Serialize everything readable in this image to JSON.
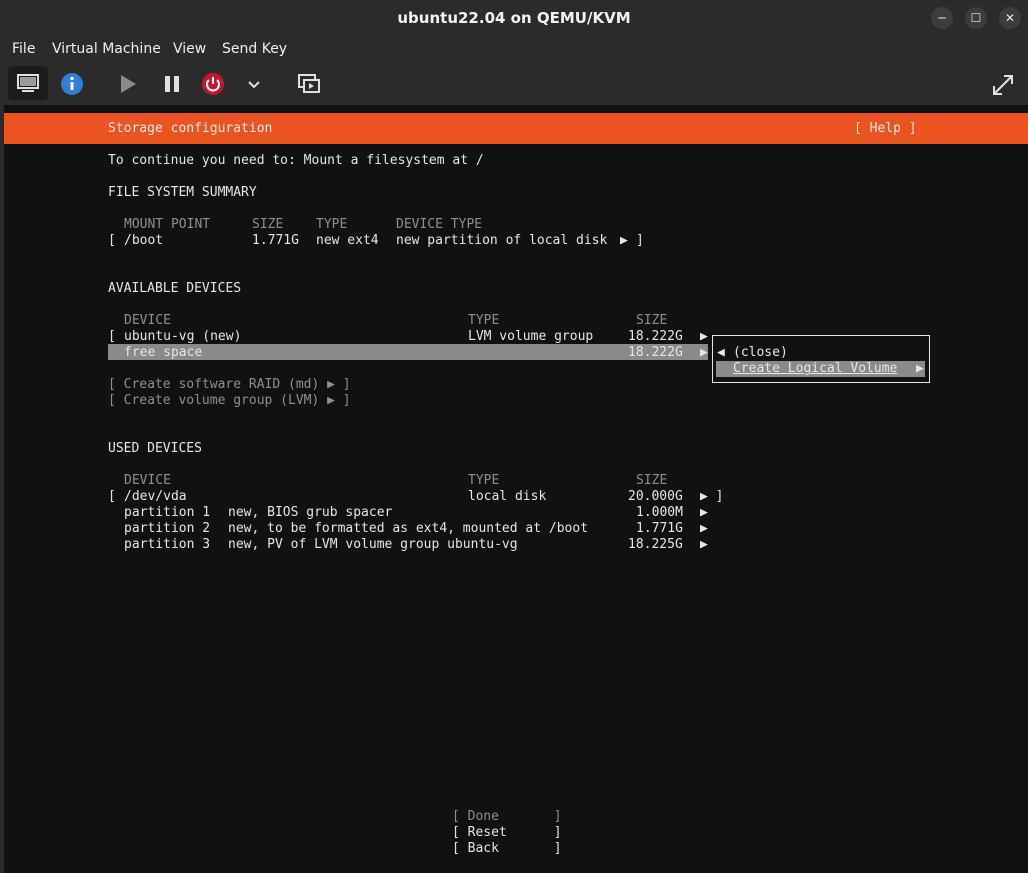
{
  "window": {
    "title": "ubuntu22.04 on QEMU/KVM",
    "controls": [
      "─",
      "☐",
      "✕"
    ]
  },
  "menubar": [
    "File",
    "Virtual Machine",
    "View",
    "Send Key"
  ],
  "installer": {
    "header_title": "Storage configuration",
    "help": "[ Help ]",
    "instruction": "To continue you need to: Mount a filesystem at /",
    "fs_summary": {
      "heading": "FILE SYSTEM SUMMARY",
      "columns": [
        "MOUNT POINT",
        "SIZE",
        "TYPE",
        "DEVICE TYPE"
      ],
      "row": {
        "bracket_open": "[",
        "mount": "/boot",
        "size": "1.771G",
        "type": "new ext4",
        "device_type": "new partition of local disk",
        "arrow": "▶",
        "bracket_close": "]"
      }
    },
    "available": {
      "heading": "AVAILABLE DEVICES",
      "columns": [
        "DEVICE",
        "TYPE",
        "SIZE"
      ],
      "vg_row": {
        "bracket": "[",
        "name": "ubuntu-vg (new)",
        "type": "LVM volume group",
        "size": "18.222G",
        "arrow": "▶"
      },
      "free_row": {
        "name": "free space",
        "size": "18.222G",
        "arrow": "▶"
      },
      "actions": [
        "[ Create software RAID (md) ▶ ]",
        "[ Create volume group (LVM) ▶ ]"
      ]
    },
    "popup": {
      "close_arrow": "◀",
      "close": "(close)",
      "create_lv": "Create Logical Volume",
      "create_arrow": "▶"
    },
    "used": {
      "heading": "USED DEVICES",
      "columns": [
        "DEVICE",
        "TYPE",
        "SIZE"
      ],
      "disk": {
        "bracket": "[",
        "name": "/dev/vda",
        "type": "local disk",
        "size": "20.000G",
        "arrow": "▶ ]"
      },
      "partitions": [
        {
          "name": "partition 1",
          "desc": "new, BIOS grub spacer",
          "size": "1.000M",
          "arrow": "▶"
        },
        {
          "name": "partition 2",
          "desc": "new, to be formatted as ext4, mounted at /boot",
          "size": "1.771G",
          "arrow": "▶"
        },
        {
          "name": "partition 3",
          "desc": "new, PV of LVM volume group ubuntu-vg",
          "size": "18.225G",
          "arrow": "▶"
        }
      ]
    },
    "buttons": {
      "done": "[ Done       ]",
      "reset": "[ Reset      ]",
      "back": "[ Back       ]"
    }
  },
  "colors": {
    "header": "#e95420",
    "highlight": "#8a8a8a",
    "terminal_bg": "#111111"
  }
}
